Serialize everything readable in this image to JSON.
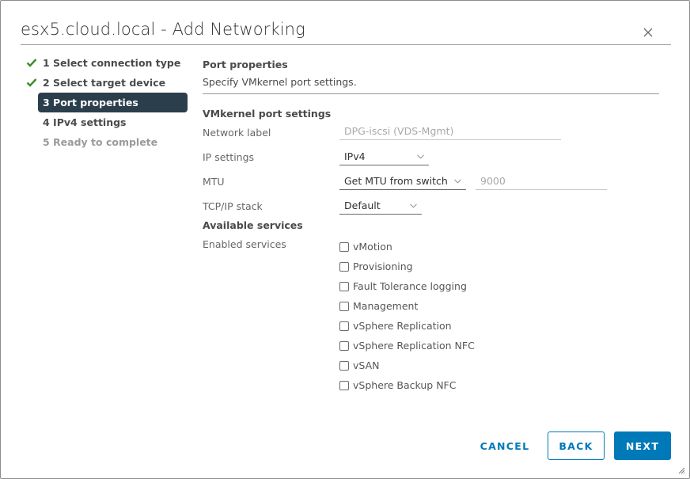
{
  "dialog": {
    "title": "esx5.cloud.local - Add Networking",
    "close_icon": "close-icon"
  },
  "steps": [
    {
      "label": "1 Select connection type",
      "state": "completed",
      "icon": "check-icon"
    },
    {
      "label": "2 Select target device",
      "state": "completed",
      "icon": "check-icon"
    },
    {
      "label": "3 Port properties",
      "state": "active"
    },
    {
      "label": "4 IPv4 settings",
      "state": "pending"
    },
    {
      "label": "5 Ready to complete",
      "state": "disabled"
    }
  ],
  "content": {
    "title": "Port properties",
    "description": "Specify VMkernel port settings.",
    "vmkernel_section_title": "VMkernel port settings",
    "network_label": {
      "label": "Network label",
      "value": "DPG-iscsi (VDS-Mgmt)"
    },
    "ip_settings": {
      "label": "IP settings",
      "value": "IPv4"
    },
    "mtu": {
      "label": "MTU",
      "value": "Get MTU from switch",
      "mtu_value": "9000"
    },
    "tcpip_stack": {
      "label": "TCP/IP stack",
      "value": "Default"
    },
    "services_section_title": "Available services",
    "enabled_services_label": "Enabled services",
    "services": [
      {
        "label": "vMotion",
        "checked": false
      },
      {
        "label": "Provisioning",
        "checked": false
      },
      {
        "label": "Fault Tolerance logging",
        "checked": false
      },
      {
        "label": "Management",
        "checked": false
      },
      {
        "label": "vSphere Replication",
        "checked": false
      },
      {
        "label": "vSphere Replication NFC",
        "checked": false
      },
      {
        "label": "vSAN",
        "checked": false
      },
      {
        "label": "vSphere Backup NFC",
        "checked": false
      }
    ]
  },
  "footer": {
    "cancel_label": "CANCEL",
    "back_label": "BACK",
    "next_label": "NEXT"
  },
  "colors": {
    "accent": "#0079b8",
    "active_step_bg": "#2b3e4c",
    "check_green": "#3c8d26"
  }
}
